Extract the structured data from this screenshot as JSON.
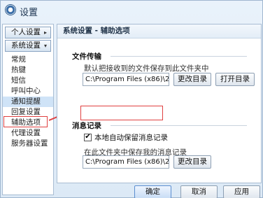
{
  "window": {
    "title": "设置"
  },
  "sidebar": {
    "groups": {
      "personal": "个人设置",
      "system": "系统设置"
    },
    "items": [
      {
        "label": "常规"
      },
      {
        "label": "热键"
      },
      {
        "label": "短信"
      },
      {
        "label": "呼叫中心"
      },
      {
        "label": "通知提醒"
      },
      {
        "label": "回复设置"
      },
      {
        "label": "辅助选项"
      },
      {
        "label": "代理设置"
      },
      {
        "label": "服务器设置"
      }
    ]
  },
  "content": {
    "header": "系统设置 - 辅助选项",
    "file_transfer": {
      "title": "文件传输",
      "description": "默认把接收到的文件保存到此文件夹中",
      "path": "C:\\Program Files (x86)\\263",
      "change_button": "更改目录",
      "open_button": "打开目录"
    },
    "message_record": {
      "title": "消息记录",
      "checkbox_label": "本地自动保留消息记录",
      "checked": true,
      "description": "在此文件夹中保存我的消息记录",
      "path": "C:\\Program Files (x86)\\263",
      "change_button": "更改目录"
    }
  },
  "footer": {
    "ok": "确定",
    "cancel": "取消",
    "apply": "应用"
  },
  "colors": {
    "highlight": "#e04040",
    "selected": "#cfe3f7"
  }
}
